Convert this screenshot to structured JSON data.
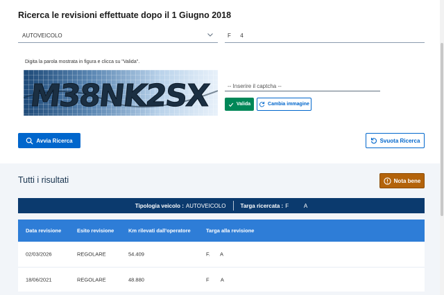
{
  "search": {
    "title": "Ricerca le revisioni effettuate dopo il 1 Giugno 2018",
    "vehicle_type": "AUTOVEICOLO",
    "plate": "F      4"
  },
  "captcha": {
    "hint": "Digita la parola mostrata in figura e clicca su \"Valida\".",
    "image_text": "M38NK2SX",
    "input_placeholder": "-- Inserire il captcha --",
    "valida_label": "Valida",
    "cambia_label": "Cambia immagine"
  },
  "actions": {
    "avvia_label": "Avvia Ricerca",
    "svuota_label": "Svuota Ricerca"
  },
  "results": {
    "title": "Tutti i risultati",
    "nota_label": "Nota bene",
    "summary": {
      "tipologia_label": "Tipologia veicolo :",
      "tipologia_value": "AUTOVEICOLO",
      "targa_label": "Targa ricercata :",
      "targa_value": "F          A"
    },
    "columns": [
      "Data revisione",
      "Esito revisione",
      "Km rilevati dall'operatore",
      "Targa alla revisione"
    ],
    "rows": [
      [
        "02/03/2026",
        "REGOLARE",
        "54.409",
        "F.       A"
      ],
      [
        "18/06/2021",
        "REGOLARE",
        "48.880",
        "F        A"
      ]
    ]
  },
  "colors": {
    "primary": "#0066cc",
    "success": "#008758",
    "warning": "#b3630b",
    "summary_bar": "#0b3a6e",
    "table_header": "#2e7dd7"
  },
  "icons": {
    "chevron": "chevron-down-icon",
    "check": "check-icon",
    "refresh": "refresh-icon",
    "search": "search-icon",
    "reset": "reset-icon",
    "alert": "alert-circle-icon"
  }
}
